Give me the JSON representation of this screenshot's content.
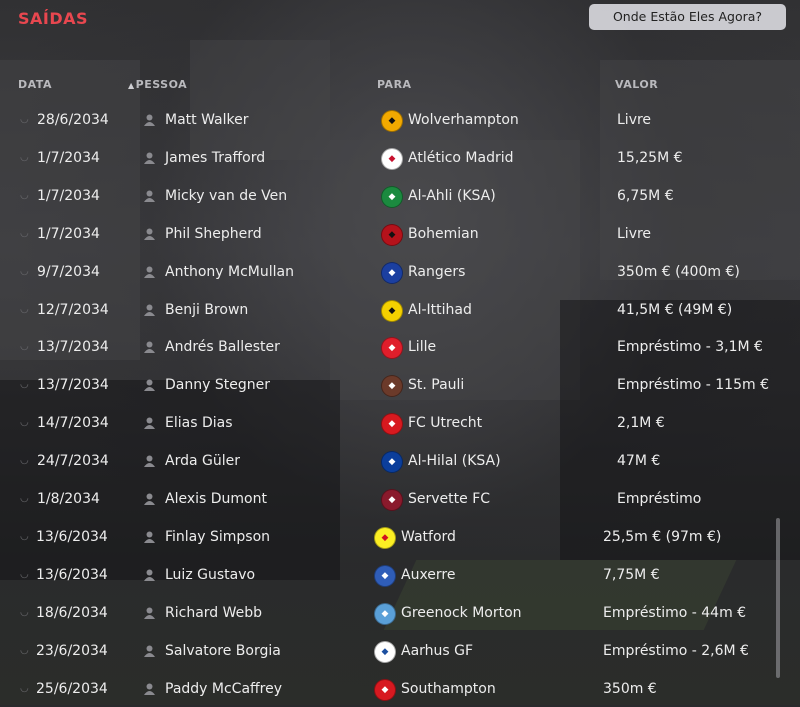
{
  "title": "SAÍDAS",
  "where_button": "Onde Estão Eles Agora?",
  "columns": {
    "date": "DATA",
    "person": "PESSOA",
    "to": "PARA",
    "value": "VALOR"
  },
  "rows": [
    {
      "date": "28/6/2034",
      "person": "Matt Walker",
      "club": "Wolverhampton",
      "value": "Livre",
      "crest": "#f2a900",
      "crest_fg": "#111"
    },
    {
      "date": "1/7/2034",
      "person": "James Trafford",
      "club": "Atlético Madrid",
      "value": "15,25M €",
      "crest": "#ffffff",
      "crest_fg": "#c8102e"
    },
    {
      "date": "1/7/2034",
      "person": "Micky van de Ven",
      "club": "Al-Ahli (KSA)",
      "value": "6,75M €",
      "crest": "#1b8a3f",
      "crest_fg": "#fff"
    },
    {
      "date": "1/7/2034",
      "person": "Phil Shepherd",
      "club": "Bohemian",
      "value": "Livre",
      "crest": "#b5121b",
      "crest_fg": "#111"
    },
    {
      "date": "9/7/2034",
      "person": "Anthony McMullan",
      "club": "Rangers",
      "value": "350m € (400m €)",
      "crest": "#1b3fa0",
      "crest_fg": "#fff"
    },
    {
      "date": "12/7/2034",
      "person": "Benji Brown",
      "club": "Al-Ittihad",
      "value": "41,5M € (49M €)",
      "crest": "#f4d000",
      "crest_fg": "#111"
    },
    {
      "date": "13/7/2034",
      "person": "Andrés Ballester",
      "club": "Lille",
      "value": "Empréstimo - 3,1M €",
      "crest": "#e01e2b",
      "crest_fg": "#fff"
    },
    {
      "date": "13/7/2034",
      "person": "Danny Stegner",
      "club": "St. Pauli",
      "value": "Empréstimo - 115m €",
      "crest": "#6b3a2a",
      "crest_fg": "#fff"
    },
    {
      "date": "14/7/2034",
      "person": "Elias Dias",
      "club": "FC Utrecht",
      "value": "2,1M €",
      "crest": "#d7191f",
      "crest_fg": "#fff"
    },
    {
      "date": "24/7/2034",
      "person": "Arda Güler",
      "club": "Al-Hilal (KSA)",
      "value": "47M €",
      "crest": "#0b3e9b",
      "crest_fg": "#fff"
    },
    {
      "date": "1/8/2034",
      "person": "Alexis Dumont",
      "club": "Servette FC",
      "value": "Empréstimo",
      "crest": "#8a1a2c",
      "crest_fg": "#fff"
    },
    {
      "date": "13/6/2034",
      "person": "Finlay Simpson",
      "club": "Watford",
      "value": "25,5m € (97m €)",
      "crest": "#fbee23",
      "crest_fg": "#d1101e"
    },
    {
      "date": "13/6/2034",
      "person": "Luiz Gustavo",
      "club": "Auxerre",
      "value": "7,75M €",
      "crest": "#2f5db8",
      "crest_fg": "#fff"
    },
    {
      "date": "18/6/2034",
      "person": "Richard Webb",
      "club": "Greenock Morton",
      "value": "Empréstimo - 44m €",
      "crest": "#5aa0d8",
      "crest_fg": "#fff"
    },
    {
      "date": "23/6/2034",
      "person": "Salvatore Borgia",
      "club": "Aarhus GF",
      "value": "Empréstimo - 2,6M €",
      "crest": "#ffffff",
      "crest_fg": "#1c4fa0"
    },
    {
      "date": "25/6/2034",
      "person": "Paddy McCaffrey",
      "club": "Southampton",
      "value": "350m €",
      "crest": "#d71920",
      "crest_fg": "#fff"
    }
  ]
}
